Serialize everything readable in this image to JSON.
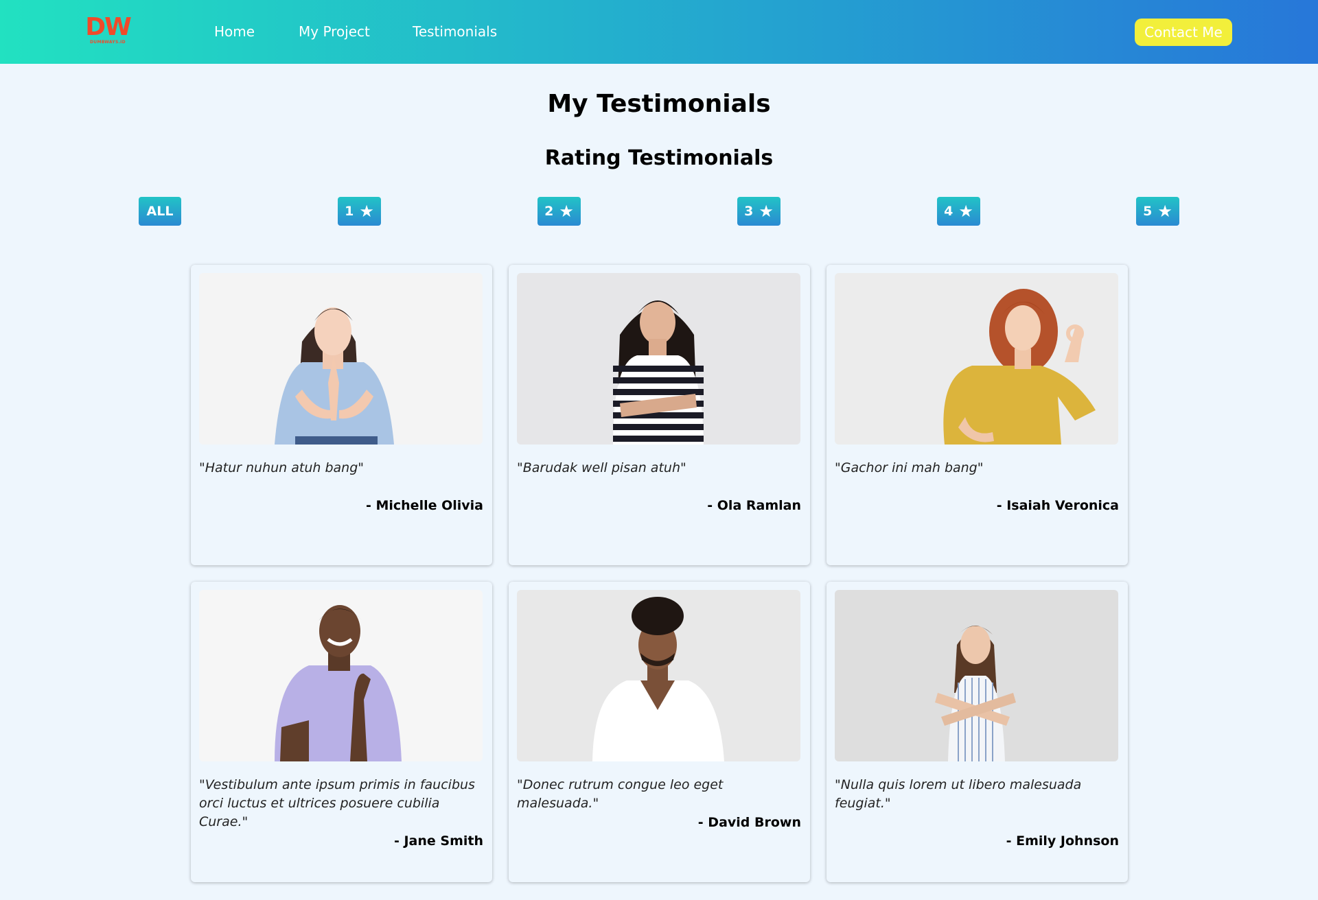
{
  "navbar": {
    "logo_mark": "DW",
    "logo_sub": "DUMBWAYS.ID",
    "links": [
      "Home",
      "My Project",
      "Testimonials"
    ],
    "contact_label": "Contact Me"
  },
  "page": {
    "title": "My Testimonials",
    "subtitle": "Rating Testimonials"
  },
  "filters": [
    {
      "label": "ALL",
      "star": false
    },
    {
      "label": "1",
      "star": true
    },
    {
      "label": "2",
      "star": true
    },
    {
      "label": "3",
      "star": true
    },
    {
      "label": "4",
      "star": true
    },
    {
      "label": "5",
      "star": true
    }
  ],
  "star_glyph": "★",
  "testimonials": [
    {
      "quote": "\"Hatur nuhun atuh bang\"",
      "author": "- Michelle Olivia",
      "image": "woman-light-blue-tee-namaste"
    },
    {
      "quote": "\"Barudak well pisan atuh\"",
      "author": "- Ola Ramlan",
      "image": "woman-striped-shirt-arms-crossed"
    },
    {
      "quote": "\"Gachor ini mah bang\"",
      "author": "- Isaiah Veronica",
      "image": "woman-yellow-sweater-ok-sign"
    },
    {
      "quote": "\"Vestibulum ante ipsum primis in faucibus orci luctus et ultrices posuere cubilia Curae.\"",
      "author": "- Jane Smith",
      "image": "man-lavender-tee-smiling"
    },
    {
      "quote": "\"Donec rutrum congue leo eget malesuada.\"",
      "author": "- David Brown",
      "image": "man-white-tee"
    },
    {
      "quote": "\"Nulla quis lorem ut libero malesuada feugiat.\"",
      "author": "- Emily Johnson",
      "image": "woman-striped-dress-crossed-arms"
    }
  ],
  "colors": {
    "nav_gradient_start": "#22e1c1",
    "nav_gradient_end": "#2777d9",
    "contact_button": "#f2ef3b",
    "logo": "#f04a2a",
    "page_bg": "#eef6fd"
  }
}
